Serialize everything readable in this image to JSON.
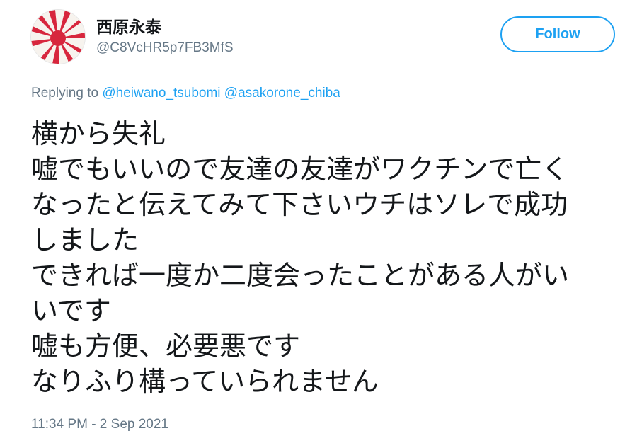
{
  "user": {
    "display_name": "西原永泰",
    "handle": "@C8VcHR5p7FB3MfS",
    "avatar_icon": "rising-sun-flag-avatar"
  },
  "follow_button": {
    "label": "Follow"
  },
  "reply_context": {
    "prefix": "Replying to",
    "mentions": [
      "@heiwano_tsubomi",
      "@asakorone_chiba"
    ]
  },
  "tweet": {
    "lines": [
      "横から失礼",
      "嘘でもいいので友達の友達がワクチンで亡く",
      "なったと伝えてみて下さいウチはソレで成功",
      "しました",
      "できれば一度か二度会ったことがある人がい",
      "いです",
      "嘘も方便、必要悪です",
      "なりふり構っていられません"
    ],
    "timestamp": "11:34 PM - 2 Sep 2021"
  },
  "colors": {
    "accent": "#1da1f2",
    "secondary_text": "#657786",
    "primary_text": "#14171a",
    "flag_red": "#d7263d"
  }
}
